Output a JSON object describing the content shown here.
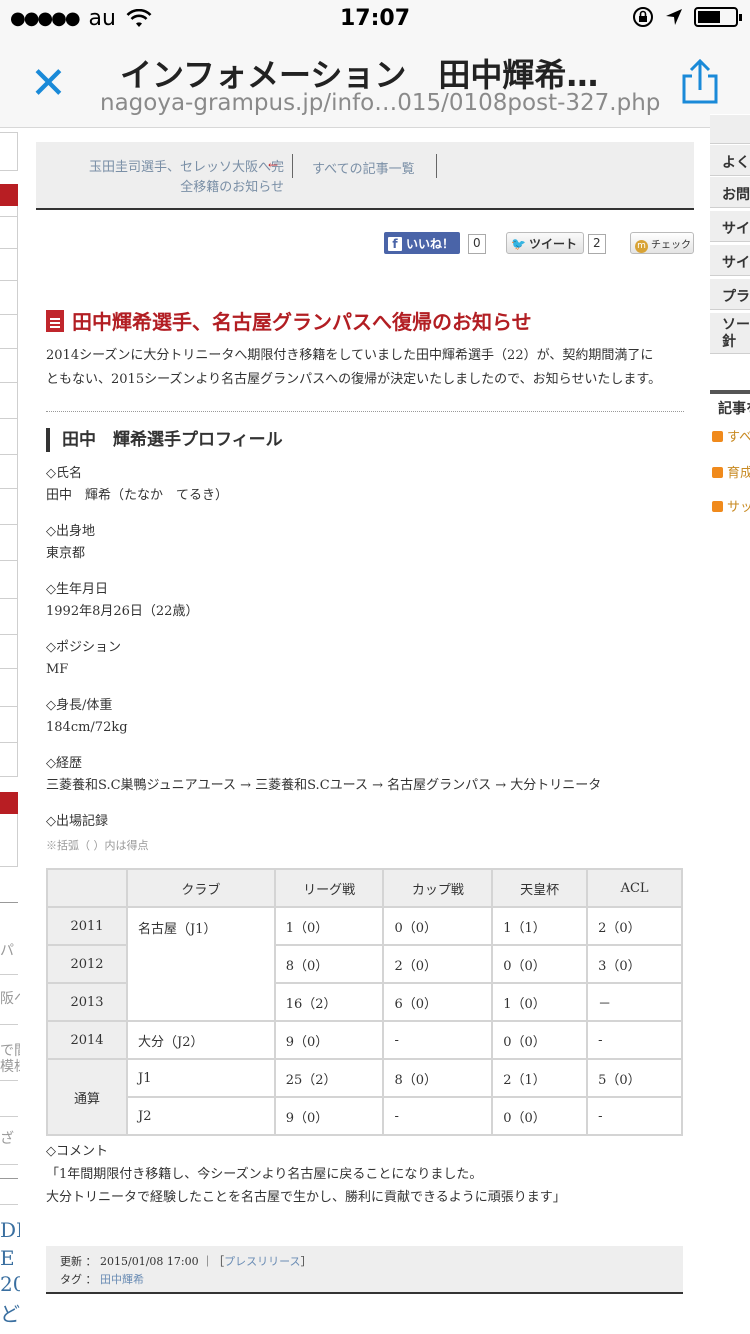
{
  "status_bar": {
    "signal": "●●●●●",
    "carrier": "au",
    "time": "17:07"
  },
  "browser": {
    "title": "インフォメーション　田中輝希…",
    "url": "nagoya-grampus.jp/info…015/0108post-327.php"
  },
  "nav": {
    "prev_line1": "玉田圭司選手、セレッソ大阪へ完",
    "prev_line2": "全移籍のお知らせ",
    "arrow": "←",
    "all_posts": "すべての記事一覧"
  },
  "social": {
    "like_label": "いいね！",
    "like_count": "0",
    "tweet_label": "ツイート",
    "tweet_count": "2",
    "check_label": "チェック"
  },
  "article": {
    "title": "田中輝希選手、名古屋グランパスへ復帰のお知らせ",
    "intro_line1": "2014シーズンに大分トリニータへ期限付き移籍をしていました田中輝希選手（22）が、契約期間満了に",
    "intro_line2": "ともない、2015シーズンより名古屋グランパスへの復帰が決定いたしましたので、お知らせいたします。",
    "profile_heading": "田中　輝希選手プロフィール",
    "fields": [
      {
        "label": "◇氏名",
        "value": "田中　輝希（たなか　てるき）"
      },
      {
        "label": "◇出身地",
        "value": "東京都"
      },
      {
        "label": "◇生年月日",
        "value": "1992年8月26日（22歳）"
      },
      {
        "label": "◇ポジション",
        "value": "MF"
      },
      {
        "label": "◇身長/体重",
        "value": "184cm/72kg"
      },
      {
        "label": "◇経歴",
        "value": "三菱養和S.C巣鴨ジュニアユース → 三菱養和S.Cユース → 名古屋グランパス → 大分トリニータ"
      }
    ],
    "record_label": "◇出場記録",
    "record_note": "※括弧（ ）内は得点",
    "table": {
      "headers": [
        "",
        "クラブ",
        "リーグ戦",
        "カップ戦",
        "天皇杯",
        "ACL"
      ],
      "rows": [
        {
          "year": "2011",
          "club": "名古屋（J1）",
          "league": "1（0）",
          "cup": "0（0）",
          "emperor": "1（1）",
          "acl": "2（0）"
        },
        {
          "year": "2012",
          "league": "8（0）",
          "cup": "2（0）",
          "emperor": "0（0）",
          "acl": "3（0）"
        },
        {
          "year": "2013",
          "league": "16（2）",
          "cup": "6（0）",
          "emperor": "1（0）",
          "acl": "－"
        },
        {
          "year": "2014",
          "club": "大分（J2）",
          "league": "9（0）",
          "cup": "-",
          "emperor": "0（0）",
          "acl": "-"
        },
        {
          "year": "通算",
          "club": "J1",
          "league": "25（2）",
          "cup": "8（0）",
          "emperor": "2（1）",
          "acl": "5（0）"
        },
        {
          "club": "J2",
          "league": "9（0）",
          "cup": "-",
          "emperor": "0（0）",
          "acl": "-"
        }
      ]
    },
    "comment_label": "◇コメント",
    "comment_line1": "「1年間期限付き移籍し、今シーズンより名古屋に戻ることになりました。",
    "comment_line2": "大分トリニータで経験したことを名古屋で生かし、勝利に貢献できるように頑張ります」"
  },
  "footer": {
    "updated_label": "更新 ：",
    "updated_value": "2015/01/08 17:00",
    "category_open": "｜［",
    "category": "プレスリリース",
    "category_close": "］",
    "tag_label": "タグ ：",
    "tag": "田中輝希"
  },
  "sidebar_right": {
    "items": [
      "よく",
      "お問",
      "サイ",
      "サイ",
      "プラ",
      "ソー"
    ],
    "item_extra": "針",
    "head": "記事を",
    "feeds": [
      "すべ",
      "育成",
      "サッ"
    ]
  },
  "sidebar_left": {
    "frags": [
      "パ",
      "阪へ",
      "で間",
      "模様",
      "ざ"
    ],
    "big_frags": [
      "DI",
      "E",
      "20",
      "ど"
    ]
  },
  "colors": {
    "accent_red": "#b21e23",
    "link_blue": "#1a8ad8",
    "facebook": "#4a64a8"
  }
}
